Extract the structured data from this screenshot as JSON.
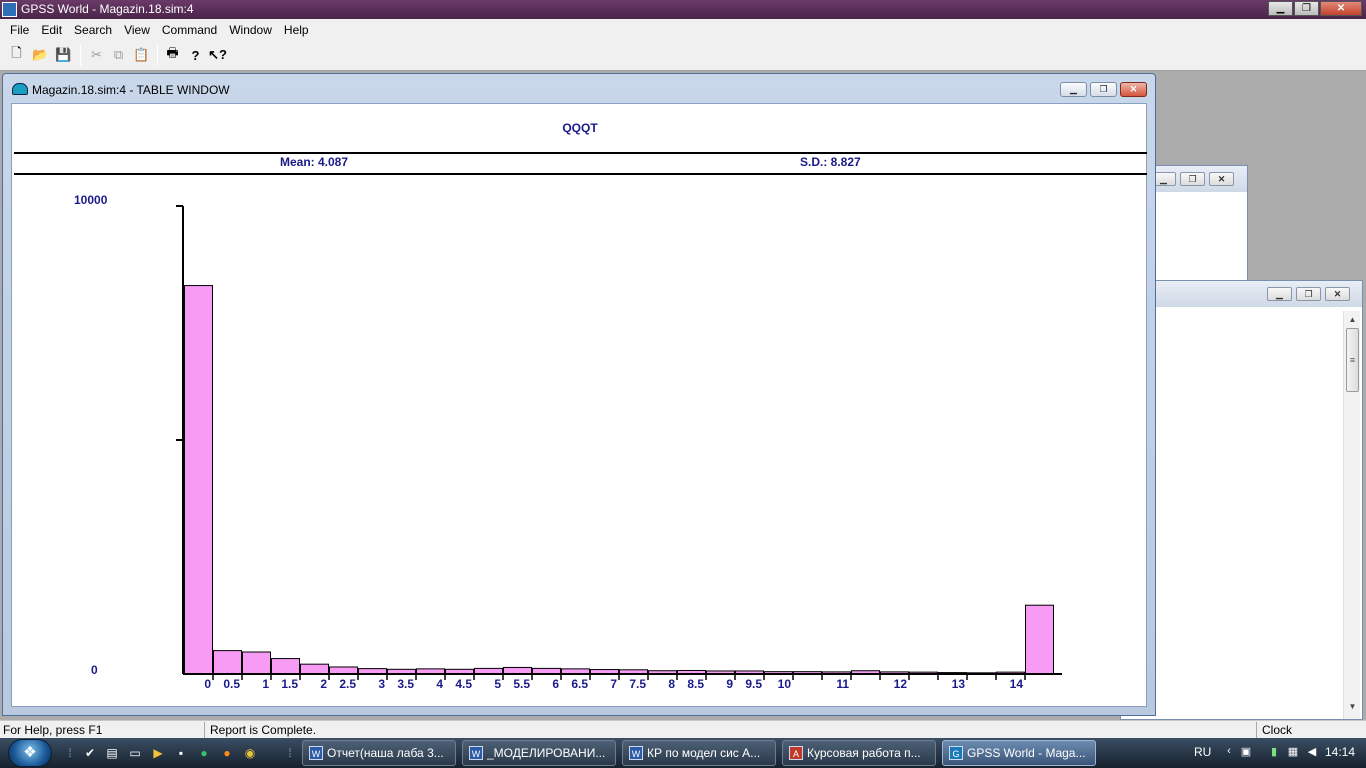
{
  "app": {
    "title": "GPSS World - Magazin.18.sim:4",
    "menu": [
      "File",
      "Edit",
      "Search",
      "View",
      "Command",
      "Window",
      "Help"
    ]
  },
  "table_window": {
    "title": "Magazin.18.sim:4  -  TABLE WINDOW",
    "table_name": "QQQT",
    "mean": "Mean: 4.087",
    "sd": "S.D.: 8.827",
    "y_max_label": "10000",
    "y_min_label": "0"
  },
  "chart_data": {
    "type": "bar",
    "title": "QQQT",
    "ylim": [
      0,
      10000
    ],
    "ytick_labels": [
      "10000",
      "0"
    ],
    "x_tick_labels": [
      "0",
      "0.5",
      "1",
      "1.5",
      "2",
      "2.5",
      "3",
      "3.5",
      "4",
      "4.5",
      "5",
      "5.5",
      "6",
      "6.5",
      "7",
      "7.5",
      "8",
      "8.5",
      "9",
      "9.5",
      "10",
      "",
      "11",
      "",
      "12",
      "",
      "13",
      "",
      "14"
    ],
    "values": [
      8300,
      500,
      470,
      330,
      210,
      150,
      115,
      100,
      110,
      100,
      120,
      140,
      120,
      110,
      95,
      90,
      70,
      75,
      65,
      65,
      50,
      50,
      45,
      70,
      45,
      40,
      30,
      25,
      40,
      1470
    ],
    "bar_color": "#f79bf5",
    "grid": false,
    "legend": "none"
  },
  "status": {
    "help": "For Help, press F1",
    "message": "Report is Complete.",
    "clock": "Clock"
  },
  "taskbar": {
    "tasks": [
      {
        "label": "Отчет(наша лаба 3...",
        "icon": "word-doc-icon"
      },
      {
        "label": "_МОДЕЛИРОВАНИ...",
        "icon": "word-doc-icon"
      },
      {
        "label": "КР по модел сис А...",
        "icon": "word-doc-icon"
      },
      {
        "label": "Курсовая работа п...",
        "icon": "pdf-icon"
      },
      {
        "label": "GPSS World - Maga...",
        "icon": "gpss-icon"
      }
    ],
    "lang": "RU",
    "time": "14:14"
  }
}
